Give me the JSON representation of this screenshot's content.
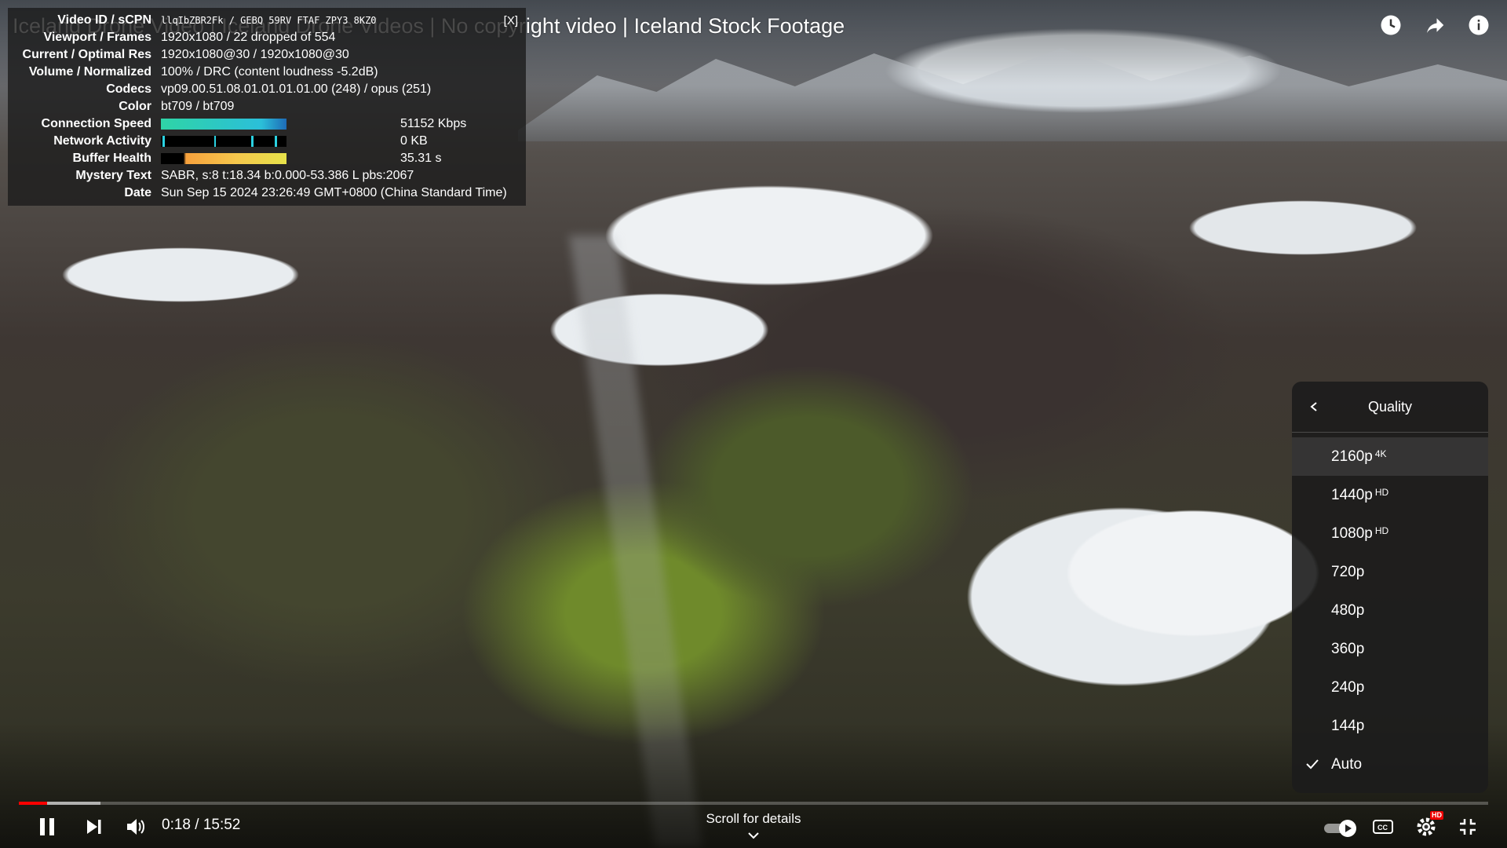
{
  "video": {
    "title": "Iceland Drone Video | Iceland Drone Videos | No copyright video | Iceland Stock Footage"
  },
  "stats": {
    "close_label": "[X]",
    "rows": [
      {
        "label": "Video ID / sCPN",
        "value": "llqIbZBR2Fk / GEBQ 59RV FTAF ZPY3 8KZ0"
      },
      {
        "label": "Viewport / Frames",
        "value": "1920x1080 / 22 dropped of 554"
      },
      {
        "label": "Current / Optimal Res",
        "value": "1920x1080@30 / 1920x1080@30"
      },
      {
        "label": "Volume / Normalized",
        "value": "100% / DRC (content loudness -5.2dB)"
      },
      {
        "label": "Codecs",
        "value": "vp09.00.51.08.01.01.01.01.00 (248) / opus (251)"
      },
      {
        "label": "Color",
        "value": "bt709 / bt709"
      },
      {
        "label": "Connection Speed",
        "value": "51152 Kbps"
      },
      {
        "label": "Network Activity",
        "value": "0 KB"
      },
      {
        "label": "Buffer Health",
        "value": "35.31 s"
      },
      {
        "label": "Mystery Text",
        "value": "SABR, s:8 t:18.34 b:0.000-53.386 L pbs:2067"
      },
      {
        "label": "Date",
        "value": "Sun Sep 15 2024 23:26:49 GMT+0800 (China Standard Time)"
      }
    ]
  },
  "quality_menu": {
    "title": "Quality",
    "items": [
      {
        "label": "2160p",
        "badge": "4K"
      },
      {
        "label": "1440p",
        "badge": "HD"
      },
      {
        "label": "1080p",
        "badge": "HD"
      },
      {
        "label": "720p",
        "badge": ""
      },
      {
        "label": "480p",
        "badge": ""
      },
      {
        "label": "360p",
        "badge": ""
      },
      {
        "label": "240p",
        "badge": ""
      },
      {
        "label": "144p",
        "badge": ""
      },
      {
        "label": "Auto",
        "badge": "",
        "selected": true
      }
    ]
  },
  "player": {
    "time": "0:18 / 15:52",
    "scroll_hint": "Scroll for details",
    "progress_played_fraction": 0.019,
    "settings_badge": "HD",
    "accent": "#ff0000"
  },
  "icons": [
    "watch-later-icon",
    "share-icon",
    "info-icon",
    "back-chevron-icon",
    "check-icon",
    "pause-icon",
    "next-icon",
    "volume-icon",
    "chevron-down-icon",
    "autoplay-toggle",
    "captions-icon",
    "settings-icon",
    "exit-fullscreen-icon"
  ]
}
